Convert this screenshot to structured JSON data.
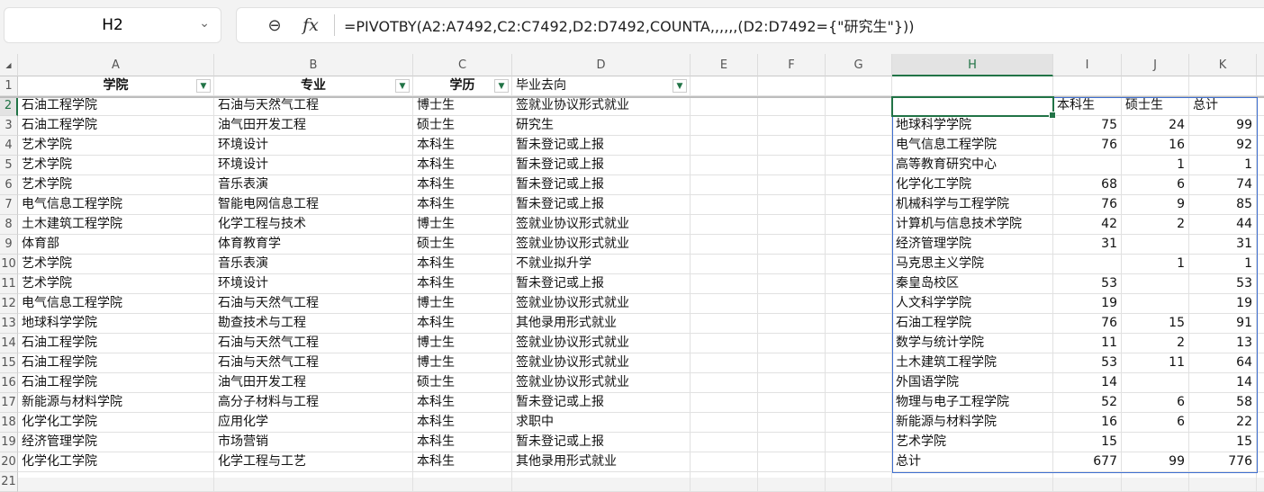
{
  "name_box": {
    "value": "H2"
  },
  "formula_bar": {
    "formula": "=PIVOTBY(A2:A7492,C2:C7492,D2:D7492,COUNTA,,,,,,(D2:D7492={\"研究生\"}))"
  },
  "columns": [
    "A",
    "B",
    "C",
    "D",
    "E",
    "F",
    "G",
    "H",
    "I",
    "J",
    "K"
  ],
  "rows": [
    "1",
    "2",
    "3",
    "4",
    "5",
    "6",
    "7",
    "8",
    "9",
    "10",
    "11",
    "12",
    "13",
    "14",
    "15",
    "16",
    "17",
    "18",
    "19",
    "20",
    "21"
  ],
  "source_headers": [
    "学院",
    "专业",
    "学历",
    "毕业去向"
  ],
  "source_rows": [
    [
      "石油工程学院",
      "石油与天然气工程",
      "博士生",
      "签就业协议形式就业"
    ],
    [
      "石油工程学院",
      "油气田开发工程",
      "硕士生",
      "研究生"
    ],
    [
      "艺术学院",
      "环境设计",
      "本科生",
      "暂未登记或上报"
    ],
    [
      "艺术学院",
      "环境设计",
      "本科生",
      "暂未登记或上报"
    ],
    [
      "艺术学院",
      "音乐表演",
      "本科生",
      "暂未登记或上报"
    ],
    [
      "电气信息工程学院",
      "智能电网信息工程",
      "本科生",
      "暂未登记或上报"
    ],
    [
      "土木建筑工程学院",
      "化学工程与技术",
      "博士生",
      "签就业协议形式就业"
    ],
    [
      "体育部",
      "体育教育学",
      "硕士生",
      "签就业协议形式就业"
    ],
    [
      "艺术学院",
      "音乐表演",
      "本科生",
      "不就业拟升学"
    ],
    [
      "艺术学院",
      "环境设计",
      "本科生",
      "暂未登记或上报"
    ],
    [
      "电气信息工程学院",
      "石油与天然气工程",
      "博士生",
      "签就业协议形式就业"
    ],
    [
      "地球科学学院",
      "勘查技术与工程",
      "本科生",
      "其他录用形式就业"
    ],
    [
      "石油工程学院",
      "石油与天然气工程",
      "博士生",
      "签就业协议形式就业"
    ],
    [
      "石油工程学院",
      "石油与天然气工程",
      "博士生",
      "签就业协议形式就业"
    ],
    [
      "石油工程学院",
      "油气田开发工程",
      "硕士生",
      "签就业协议形式就业"
    ],
    [
      "新能源与材料学院",
      "高分子材料与工程",
      "本科生",
      "暂未登记或上报"
    ],
    [
      "化学化工学院",
      "应用化学",
      "本科生",
      "求职中"
    ],
    [
      "经济管理学院",
      "市场营销",
      "本科生",
      "暂未登记或上报"
    ],
    [
      "化学化工学院",
      "化学工程与工艺",
      "本科生",
      "其他录用形式就业"
    ]
  ],
  "pivot": {
    "headers": [
      "",
      "本科生",
      "硕士生",
      "总计"
    ],
    "rows": [
      [
        "地球科学学院",
        "75",
        "24",
        "99"
      ],
      [
        "电气信息工程学院",
        "76",
        "16",
        "92"
      ],
      [
        "高等教育研究中心",
        "",
        "1",
        "1"
      ],
      [
        "化学化工学院",
        "68",
        "6",
        "74"
      ],
      [
        "机械科学与工程学院",
        "76",
        "9",
        "85"
      ],
      [
        "计算机与信息技术学院",
        "42",
        "2",
        "44"
      ],
      [
        "经济管理学院",
        "31",
        "",
        "31"
      ],
      [
        "马克思主义学院",
        "",
        "1",
        "1"
      ],
      [
        "秦皇岛校区",
        "53",
        "",
        "53"
      ],
      [
        "人文科学学院",
        "19",
        "",
        "19"
      ],
      [
        "石油工程学院",
        "76",
        "15",
        "91"
      ],
      [
        "数学与统计学院",
        "11",
        "2",
        "13"
      ],
      [
        "土木建筑工程学院",
        "53",
        "11",
        "64"
      ],
      [
        "外国语学院",
        "14",
        "",
        "14"
      ],
      [
        "物理与电子工程学院",
        "52",
        "6",
        "58"
      ],
      [
        "新能源与材料学院",
        "16",
        "6",
        "22"
      ],
      [
        "艺术学院",
        "15",
        "",
        "15"
      ],
      [
        "总计",
        "677",
        "99",
        "776"
      ]
    ]
  }
}
